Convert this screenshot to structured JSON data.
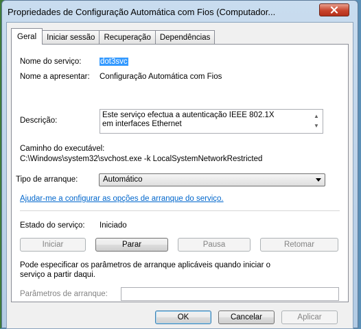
{
  "window": {
    "title": "Propriedades de Configuração Automática com Fios (Computador..."
  },
  "tabs": [
    {
      "label": "Geral"
    },
    {
      "label": "Iniciar sessão"
    },
    {
      "label": "Recuperação"
    },
    {
      "label": "Dependências"
    }
  ],
  "general": {
    "service_name_label": "Nome do serviço:",
    "service_name_value": "dot3svc",
    "display_name_label": "Nome a apresentar:",
    "display_name_value": "Configuração Automática com Fios",
    "description_label": "Descrição:",
    "description_line1": "Este serviço efectua a autenticação IEEE 802.1X",
    "description_line2": "em interfaces Ethernet",
    "exe_path_label": "Caminho do executável:",
    "exe_path_value": "C:\\Windows\\system32\\svchost.exe -k LocalSystemNetworkRestricted",
    "startup_type_label": "Tipo de arranque:",
    "startup_type_value": "Automático",
    "help_link": "Ajudar-me a configurar as opções de arranque do serviço.",
    "service_status_label": "Estado do serviço:",
    "service_status_value": "Iniciado",
    "start_button": "Iniciar",
    "stop_button": "Parar",
    "pause_button": "Pausa",
    "resume_button": "Retomar",
    "params_hint_line1": "Pode especificar os parâmetros de arranque aplicáveis quando iniciar o",
    "params_hint_line2": "serviço a partir daqui.",
    "start_params_label": "Parâmetros de arranque:",
    "start_params_value": ""
  },
  "footer": {
    "ok_button": "OK",
    "cancel_button": "Cancelar",
    "apply_button": "Aplicar"
  },
  "colors": {
    "selection": "#3399ff",
    "link": "#0066cc",
    "close_button": "#c8442c"
  }
}
